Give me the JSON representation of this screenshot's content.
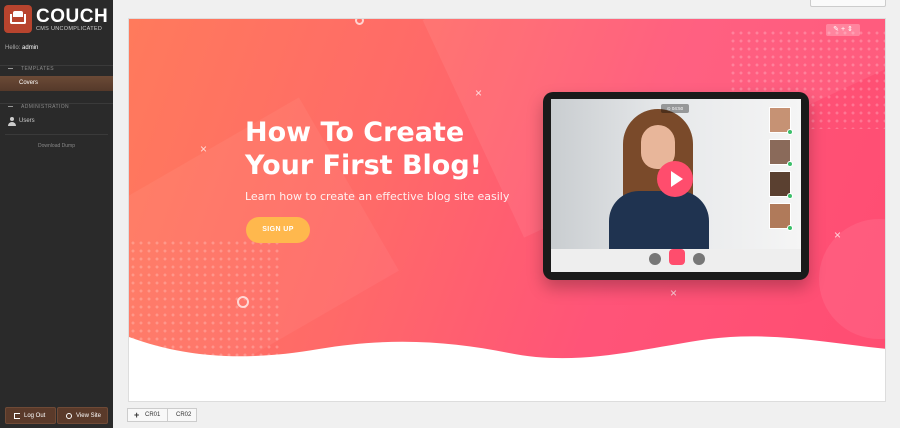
{
  "app": {
    "logo_name": "COUCH",
    "logo_tagline": "CMS UNCOMPLICATED",
    "hello_prefix": "Hello:",
    "hello_user": "admin"
  },
  "sidebar": {
    "templates_heading": "TEMPLATES",
    "covers_label": "Covers",
    "admin_heading": "ADMINISTRATION",
    "users_label": "Users",
    "download_label": "Download Dump",
    "logout_label": "Log Out",
    "viewsite_label": "View Site"
  },
  "banner": {
    "title": "How To Create Your First Blog!",
    "subtitle": "Learn how to create an effective blog site easily",
    "cta_label": "SIGN UP",
    "timer": "⊙ 04:50",
    "edit_tools": "✎ + ⇕"
  },
  "tabs": {
    "add_label": "CR01",
    "second_label": "CR02"
  },
  "colors": {
    "sidebar_bg": "#2a2a2a",
    "accent_brown": "#5a3a2a",
    "banner_pink": "#ff5a78",
    "cta_orange": "#ffb84d"
  }
}
